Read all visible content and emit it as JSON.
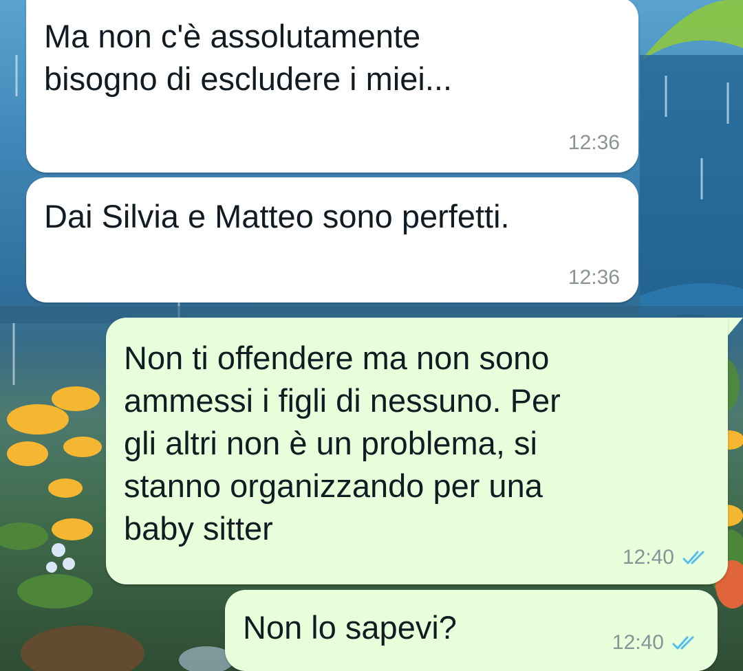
{
  "messages": [
    {
      "direction": "incoming",
      "text": "Ma non c'è assolutamente\nbisogno di escludere i miei...",
      "time": "12:36"
    },
    {
      "direction": "incoming",
      "text": "Dai Silvia e Matteo sono perfetti.",
      "time": "12:36"
    },
    {
      "direction": "outgoing",
      "text": "Non ti offendere ma non sono\nammessi i figli di nessuno. Per\ngli altri non è un problema, si\nstanno organizzando per una\nbaby sitter",
      "time": "12:40",
      "status_icon": "double-check-read-icon"
    },
    {
      "direction": "outgoing",
      "text": "Non lo sapevi?",
      "time": "12:40",
      "status_icon": "double-check-read-icon"
    }
  ],
  "colors": {
    "incoming_bubble": "#ffffff",
    "outgoing_bubble": "#e7ffdb",
    "text": "#111b21",
    "meta_text": "#8a9296",
    "read_ticks": "#53bdeb"
  }
}
